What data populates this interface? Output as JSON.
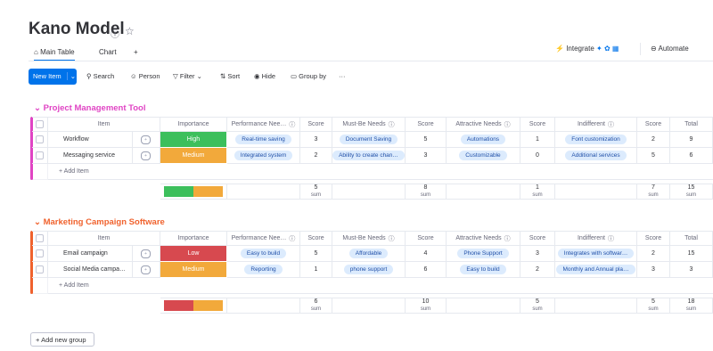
{
  "board": {
    "title": "Kano Model",
    "tabs": [
      {
        "label": "Main Table",
        "active": true,
        "icon": "home-icon"
      },
      {
        "label": "Chart",
        "active": false
      },
      {
        "label": "+",
        "active": false
      }
    ],
    "integrate_label": "Integrate",
    "automate_label": "Automate"
  },
  "toolbar": {
    "new_item_label": "New Item",
    "search_label": "Search",
    "person_label": "Person",
    "filter_label": "Filter",
    "sort_label": "Sort",
    "hide_label": "Hide",
    "group_by_label": "Group by",
    "more_label": "···"
  },
  "columns": {
    "item": "Item",
    "importance": "Importance",
    "performance": "Performance Nee…",
    "score": "Score",
    "must_be": "Must-Be Needs",
    "attractive": "Attractive Needs",
    "indifferent": "Indifferent",
    "total": "Total"
  },
  "groups": [
    {
      "name": "Project Management Tool",
      "color": "#e044c4",
      "rows": [
        {
          "item": "Workflow",
          "importance": "High",
          "importance_color": "#3cbf5c",
          "performance": "Real-time saving",
          "perf_score": "3",
          "must_be": "Document Saving",
          "must_score": "5",
          "attractive": "Automations",
          "attr_score": "1",
          "indifferent": "Font customization",
          "ind_score": "2",
          "total": "9"
        },
        {
          "item": "Messaging service",
          "importance": "Medium",
          "importance_color": "#f2a93b",
          "performance": "Integrated system",
          "perf_score": "2",
          "must_be": "Ability to create chan…",
          "must_score": "3",
          "attractive": "Customizable",
          "attr_score": "0",
          "indifferent": "Additional services",
          "ind_score": "5",
          "total": "6"
        }
      ],
      "add_item_label": "+ Add Item",
      "sums": {
        "perf": "5",
        "must": "8",
        "attr": "1",
        "ind": "7",
        "total": "15"
      },
      "sum_label": "sum"
    },
    {
      "name": "Marketing Campaign Software",
      "color": "#f0622d",
      "rows": [
        {
          "item": "Email campaign",
          "importance": "Low",
          "importance_color": "#d7494f",
          "performance": "Easy to build",
          "perf_score": "5",
          "must_be": "Affordable",
          "must_score": "4",
          "attractive": "Phone Support",
          "attr_score": "3",
          "indifferent": "Integrates with softwar…",
          "ind_score": "2",
          "total": "15"
        },
        {
          "item": "Social Media campa…",
          "importance": "Medium",
          "importance_color": "#f2a93b",
          "performance": "Reporting",
          "perf_score": "1",
          "must_be": "phone support",
          "must_score": "6",
          "attractive": "Easy to build",
          "attr_score": "2",
          "indifferent": "Monthly and Annual pla…",
          "ind_score": "3",
          "total": "3"
        }
      ],
      "add_item_label": "+ Add Item",
      "sums": {
        "perf": "6",
        "must": "10",
        "attr": "5",
        "ind": "5",
        "total": "18"
      },
      "sum_label": "sum"
    }
  ],
  "add_group_label": "Add new group"
}
